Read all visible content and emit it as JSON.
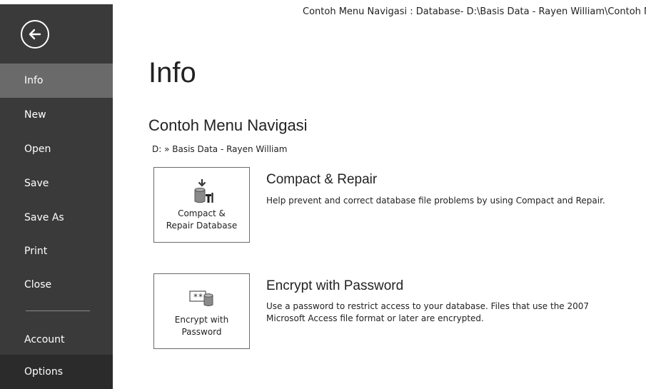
{
  "window": {
    "title": "Contoh Menu Navigasi : Database- D:\\Basis Data - Rayen William\\Contoh M"
  },
  "sidebar": {
    "back_icon": "back-arrow-icon",
    "items": [
      {
        "label": "Info"
      },
      {
        "label": "New"
      },
      {
        "label": "Open"
      },
      {
        "label": "Save"
      },
      {
        "label": "Save As"
      },
      {
        "label": "Print"
      },
      {
        "label": "Close"
      },
      {
        "label": "Account"
      },
      {
        "label": "Options"
      }
    ],
    "active_item": "Info",
    "colors": {
      "background": "#3a3a3a",
      "active": "#6a6a6a",
      "options": "#2b2b2b"
    }
  },
  "main": {
    "title": "Info",
    "db_name": "Contoh Menu Navigasi",
    "db_path": "D: » Basis Data - Rayen William",
    "actions": [
      {
        "icon": "compact-repair-database-icon",
        "tile_line1": "Compact &",
        "tile_line2": "Repair Database",
        "title": "Compact & Repair",
        "description": "Help prevent and correct database file problems by using Compact and Repair."
      },
      {
        "icon": "encrypt-password-database-icon",
        "tile_line1": "Encrypt with",
        "tile_line2": "Password",
        "title": "Encrypt with Password",
        "description_line1": "Use a password to restrict access to your database. Files that use the 2007",
        "description_line2": "Microsoft Access file format or later are encrypted."
      }
    ]
  }
}
